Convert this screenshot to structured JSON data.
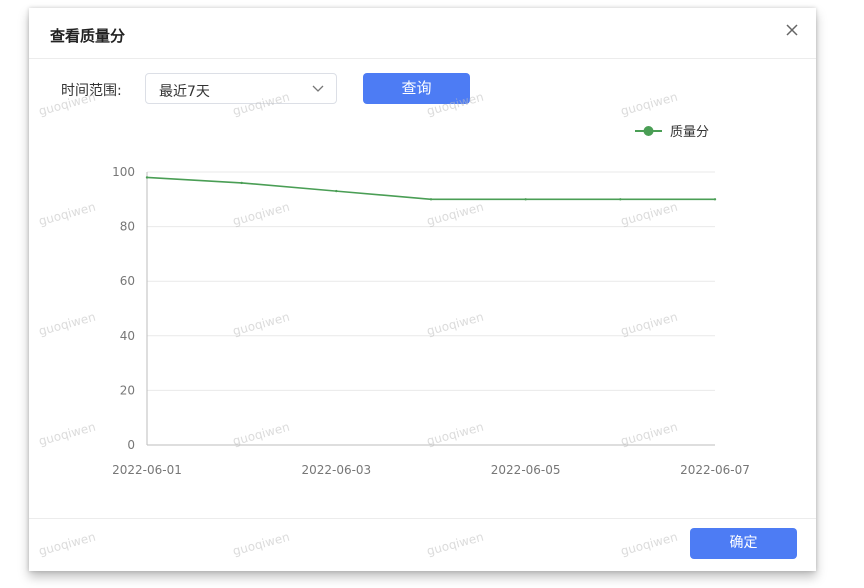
{
  "dialog": {
    "title": "查看质量分",
    "close_icon": "close-icon"
  },
  "filter": {
    "label": "时间范围:",
    "selected": "最近7天",
    "query_label": "查询"
  },
  "footer": {
    "confirm_label": "确定"
  },
  "watermark": "guoqiwen",
  "colors": {
    "accent": "#4d7cf4",
    "series": "#4a9e55",
    "grid": "#e9e9e9",
    "axis": "#bdbdbd"
  },
  "chart_data": {
    "type": "line",
    "x": [
      "2022-06-01",
      "2022-06-02",
      "2022-06-03",
      "2022-06-04",
      "2022-06-05",
      "2022-06-06",
      "2022-06-07"
    ],
    "x_tick_labels": [
      "2022-06-01",
      "2022-06-03",
      "2022-06-05",
      "2022-06-07"
    ],
    "series": [
      {
        "name": "质量分",
        "values": [
          98,
          96,
          93,
          90,
          90,
          90,
          90
        ]
      }
    ],
    "ylim": [
      0,
      100
    ],
    "y_ticks": [
      "0",
      "20",
      "40",
      "60",
      "80",
      "100"
    ],
    "grid": true,
    "legend": "top-right"
  }
}
